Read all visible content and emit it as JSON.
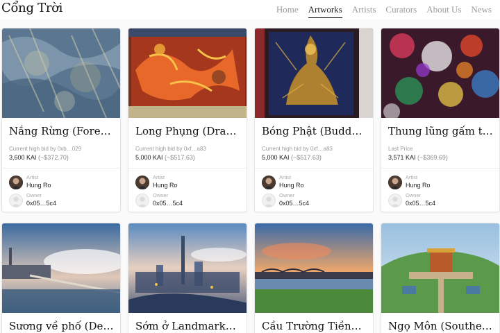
{
  "header": {
    "logo": "Cổng Trời",
    "nav": [
      {
        "label": "Home",
        "active": false
      },
      {
        "label": "Artworks",
        "active": true
      },
      {
        "label": "Artists",
        "active": false
      },
      {
        "label": "Curators",
        "active": false
      },
      {
        "label": "About Us",
        "active": false
      },
      {
        "label": "News",
        "active": false
      }
    ]
  },
  "cards": [
    {
      "title": "Nắng Rừng (Forest…",
      "bid_label": "Current high bid by 0xb…029",
      "price": "3,600 KAI",
      "price_usd": "(~$372.70)",
      "artist_label": "Artist",
      "artist": "Hung Ro",
      "owner_label": "Owner",
      "owner": "0x05…5c4"
    },
    {
      "title": "Long Phụng (Drago…",
      "bid_label": "Current high bid by 0xf…a83",
      "price": "5,000 KAI",
      "price_usd": "(~$517.63)",
      "artist_label": "Artist",
      "artist": "Hung Ro",
      "owner_label": "Owner",
      "owner": "0x05…5c4"
    },
    {
      "title": "Bóng Phật (Buddha'…",
      "bid_label": "Current high bid by 0xf…a83",
      "price": "5,000 KAI",
      "price_usd": "(~$517.63)",
      "artist_label": "Artist",
      "artist": "Hung Ro",
      "owner_label": "Owner",
      "owner": "0x05…5c4"
    },
    {
      "title": "Thung lũng gấm trờ…",
      "bid_label": "Last Price",
      "price": "3,571 KAI",
      "price_usd": "(~$369.69)",
      "artist_label": "Artist",
      "artist": "Hung Ro",
      "owner_label": "Owner",
      "owner": "0x05…5c4"
    },
    {
      "title": "Sương về phố (Dew…"
    },
    {
      "title": "Sớm ở Landmark…"
    },
    {
      "title": "Cầu Trường Tiền…"
    },
    {
      "title": "Ngọ Môn (Southern…"
    }
  ],
  "colors": {
    "nav_active": "#222222",
    "nav_inactive": "#9a9a9a",
    "card_border": "#e6e6e6"
  }
}
